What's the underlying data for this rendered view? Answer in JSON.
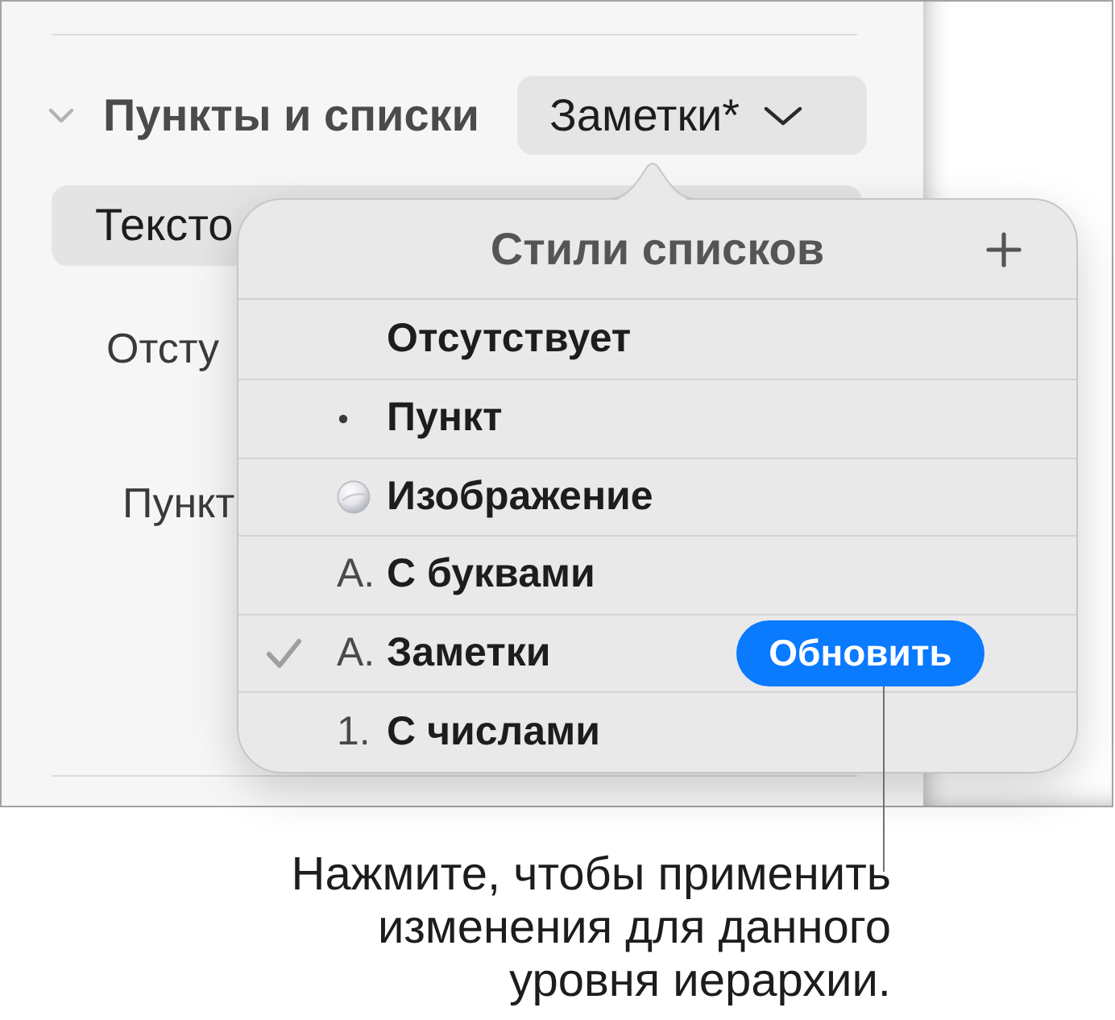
{
  "sidebar": {
    "section": {
      "title": "Пункты и списки",
      "expanded": true,
      "style_popup": "Заметки*"
    },
    "text_popup": "Тексто",
    "labels": [
      "Отсту",
      "Пункт"
    ]
  },
  "popover": {
    "title": "Стили списков",
    "items": [
      {
        "label": "Отсутствует",
        "kind": "none",
        "selected": false
      },
      {
        "label": "Пункт",
        "kind": "bullet",
        "selected": false
      },
      {
        "label": "Изображение",
        "kind": "image",
        "selected": false
      },
      {
        "label": "С буквами",
        "kind": "text",
        "marker": "A.",
        "selected": false
      },
      {
        "label": "Заметки",
        "kind": "text",
        "marker": "A.",
        "selected": true,
        "action": "Обновить"
      },
      {
        "label": "С числами",
        "kind": "text",
        "marker": "1.",
        "selected": false
      }
    ]
  },
  "callout": {
    "lines": [
      "Нажмите, чтобы применить",
      "изменения для данного",
      "уровня иерархии."
    ]
  }
}
